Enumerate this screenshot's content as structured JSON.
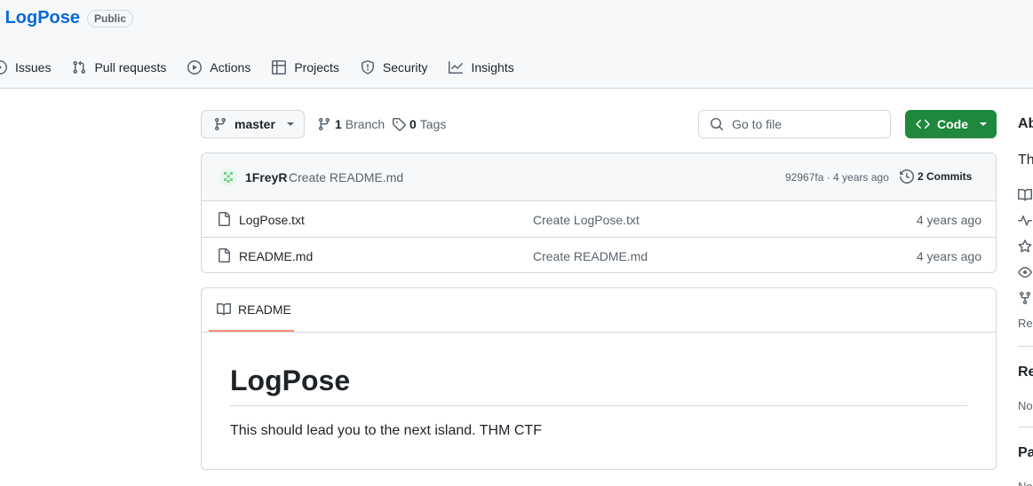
{
  "repo": {
    "name": "LogPose",
    "visibility": "Public"
  },
  "tabs": [
    {
      "label": "Issues",
      "icon": "issue-opened-icon"
    },
    {
      "label": "Pull requests",
      "icon": "git-pull-request-icon"
    },
    {
      "label": "Actions",
      "icon": "play-icon"
    },
    {
      "label": "Projects",
      "icon": "table-icon"
    },
    {
      "label": "Security",
      "icon": "shield-icon"
    },
    {
      "label": "Insights",
      "icon": "graph-icon"
    }
  ],
  "toolbar": {
    "branch": "master",
    "branches_count": "1",
    "branches_label": "Branch",
    "tags_count": "0",
    "tags_label": "Tags",
    "search_placeholder": "Go to file",
    "code_label": "Code"
  },
  "latest_commit": {
    "author": "1FreyR",
    "message": "Create README.md",
    "hash_age": "92967fa · 4 years ago",
    "commits": "2 Commits"
  },
  "files": [
    {
      "name": "LogPose.txt",
      "message": "Create LogPose.txt",
      "age": "4 years ago"
    },
    {
      "name": "README.md",
      "message": "Create README.md",
      "age": "4 years ago"
    }
  ],
  "readme": {
    "tab_label": "README",
    "heading": "LogPose",
    "body": "This should lead you to the next island. THM CTF"
  },
  "sidebar": {
    "about_heading": "Ab",
    "about_text": "Th",
    "readme_link": "Rep",
    "releases_heading": "Re",
    "releases_text": "No",
    "packages_heading": "Pa",
    "packages_text": "No"
  },
  "colors": {
    "accent": "#0969da",
    "primary_button": "#1f883d",
    "tab_underline": "#fd8c73"
  }
}
